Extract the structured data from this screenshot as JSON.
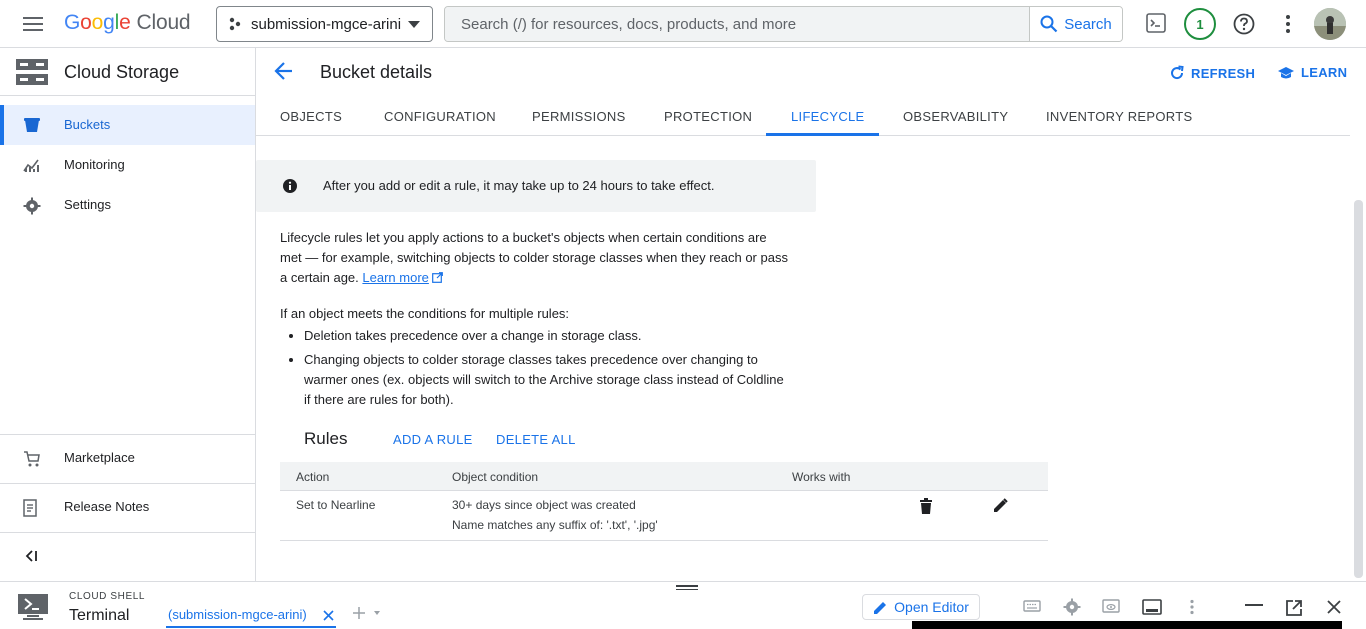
{
  "topbar": {
    "logo_parts": [
      "G",
      "o",
      "o",
      "g",
      "l",
      "e"
    ],
    "logo_suffix": "Cloud",
    "project_name": "submission-mgce-arini",
    "search_placeholder": "Search (/) for resources, docs, products, and more",
    "search_button": "Search",
    "notification_count": "1"
  },
  "sidebar": {
    "title": "Cloud Storage",
    "items": [
      {
        "label": "Buckets",
        "icon": "bucket-icon"
      },
      {
        "label": "Monitoring",
        "icon": "chart-icon"
      },
      {
        "label": "Settings",
        "icon": "gear-icon"
      }
    ],
    "bottom_items": [
      {
        "label": "Marketplace",
        "icon": "cart-icon"
      },
      {
        "label": "Release Notes",
        "icon": "notes-icon"
      }
    ]
  },
  "page": {
    "title": "Bucket details",
    "refresh_label": "REFRESH",
    "learn_label": "LEARN"
  },
  "tabs": [
    "OBJECTS",
    "CONFIGURATION",
    "PERMISSIONS",
    "PROTECTION",
    "LIFECYCLE",
    "OBSERVABILITY",
    "INVENTORY REPORTS"
  ],
  "active_tab": "LIFECYCLE",
  "lifecycle": {
    "info": "After you add or edit a rule, it may take up to 24 hours to take effect.",
    "intro_line1": "Lifecycle rules let you apply actions to a bucket's objects when certain conditions are",
    "intro_line2": "met — for example, switching objects to colder storage classes when they reach or pass",
    "intro_line3": "a certain age.",
    "learn_more": "Learn more",
    "multi_intro": "If an object meets the conditions for multiple rules:",
    "bullet1": "Deletion takes precedence over a change in storage class.",
    "bullet2_line1": "Changing objects to colder storage classes takes precedence over changing to",
    "bullet2_line2": "warmer ones (ex. objects will switch to the Archive storage class instead of Coldline",
    "bullet2_line3": "if there are rules for both).",
    "rules_heading": "Rules",
    "add_rule": "ADD A RULE",
    "delete_all": "DELETE ALL",
    "table": {
      "headers": [
        "Action",
        "Object condition",
        "Works with"
      ],
      "rows": [
        {
          "action": "Set to Nearline",
          "condition_line1": "30+ days since object was created",
          "condition_line2": "Name matches any suffix of: '.txt', '.jpg'",
          "works_with": ""
        }
      ]
    }
  },
  "shell": {
    "caption": "CLOUD SHELL",
    "terminal_label": "Terminal",
    "tab_label": "(submission-mgce-arini)",
    "open_editor": "Open Editor"
  },
  "colors": {
    "accent": "#1a73e8",
    "active_bg": "#e8f0fe",
    "notif_green": "#1e8e3e"
  }
}
